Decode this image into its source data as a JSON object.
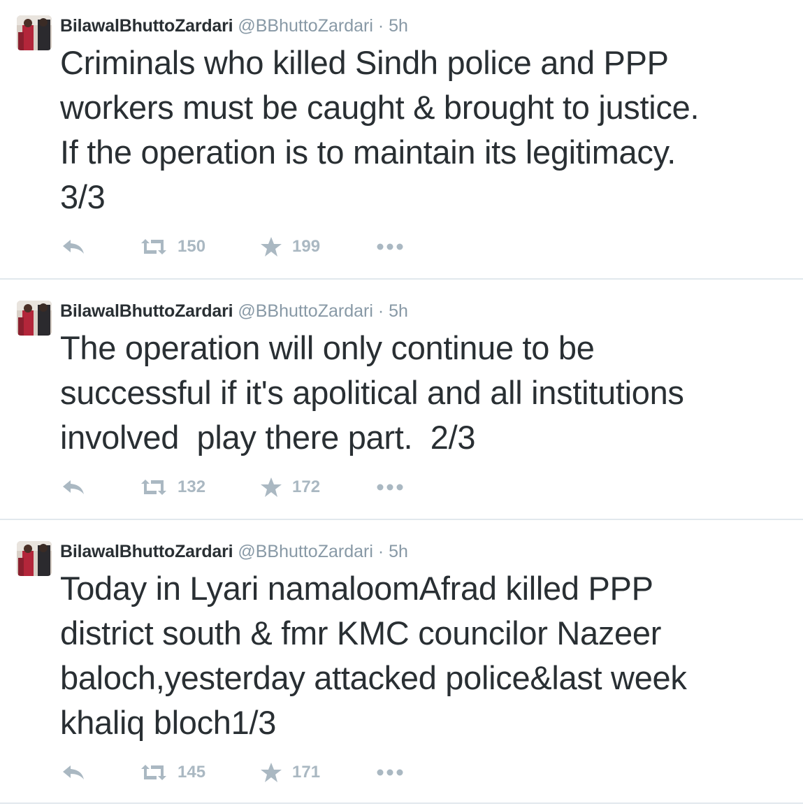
{
  "colors": {
    "name": "#292f33",
    "meta": "#8899a6",
    "action": "#aab8c2",
    "divider": "#e1e8ed"
  },
  "tweets": [
    {
      "fullname": "BilawalBhuttoZardari",
      "username": "@BBhuttoZardari",
      "separator": "·",
      "time": "5h",
      "text": "Criminals who killed Sindh police and PPP\nworkers must be caught & brought to justice.\nIf the operation is to maintain its legitimacy.\n3/3",
      "retweets": "150",
      "favorites": "199",
      "avatar_icon": "profile-photo",
      "reply_icon": "reply-icon",
      "retweet_icon": "retweet-icon",
      "favorite_icon": "star-icon",
      "more_icon": "more-dots-icon"
    },
    {
      "fullname": "BilawalBhuttoZardari",
      "username": "@BBhuttoZardari",
      "separator": "·",
      "time": "5h",
      "text": "The operation will only continue to be\nsuccessful if it's apolitical and all institutions\ninvolved  play there part.  2/3",
      "retweets": "132",
      "favorites": "172",
      "avatar_icon": "profile-photo",
      "reply_icon": "reply-icon",
      "retweet_icon": "retweet-icon",
      "favorite_icon": "star-icon",
      "more_icon": "more-dots-icon"
    },
    {
      "fullname": "BilawalBhuttoZardari",
      "username": "@BBhuttoZardari",
      "separator": "·",
      "time": "5h",
      "text": "Today in Lyari namaloomAfrad killed PPP\ndistrict south & fmr KMC councilor Nazeer\nbaloch,yesterday attacked police&last week\nkhaliq bloch1/3",
      "retweets": "145",
      "favorites": "171",
      "avatar_icon": "profile-photo",
      "reply_icon": "reply-icon",
      "retweet_icon": "retweet-icon",
      "favorite_icon": "star-icon",
      "more_icon": "more-dots-icon"
    }
  ]
}
